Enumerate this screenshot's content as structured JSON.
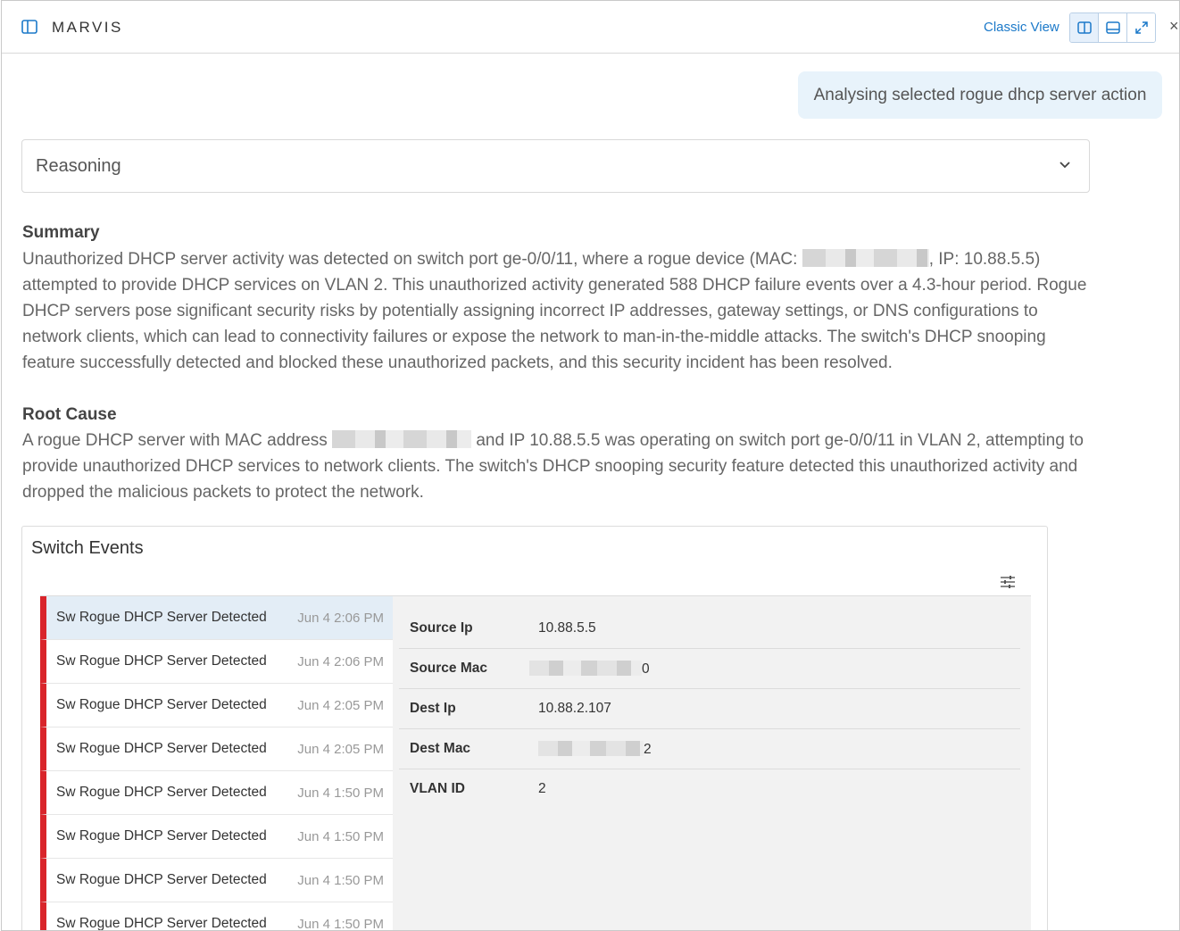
{
  "header": {
    "brand": "MARVIS",
    "classic_view": "Classic View",
    "buttons": [
      "split-view-icon",
      "bottom-panel-icon",
      "expand-icon"
    ],
    "close": "×"
  },
  "chat": {
    "user_message": "Analysing selected rogue dhcp server action"
  },
  "reasoning": {
    "label": "Reasoning"
  },
  "summary": {
    "title": "Summary",
    "text_before_mac": "Unauthorized DHCP server activity was detected on switch port ge-0/0/11, where a rogue device (MAC: ",
    "text_after_mac": ", IP: 10.88.5.5) attempted to provide DHCP services on VLAN 2. This unauthorized activity generated 588 DHCP failure events over a 4.3-hour period. Rogue DHCP servers pose significant security risks by potentially assigning incorrect IP addresses, gateway settings, or DNS configurations to network clients, which can lead to connectivity failures or expose the network to man-in-the-middle attacks. The switch's DHCP snooping feature successfully detected and blocked these unauthorized packets, and this security incident has been resolved."
  },
  "root_cause": {
    "title": "Root Cause",
    "text_before_mac": "A rogue DHCP server with MAC address ",
    "text_after_mac": " and IP 10.88.5.5 was operating on switch port ge-0/0/11 in VLAN 2, attempting to provide unauthorized DHCP services to network clients. The switch's DHCP snooping security feature detected this unauthorized activity and dropped the malicious packets to protect the network."
  },
  "switch_events": {
    "title": "Switch Events",
    "events": [
      {
        "name": "Sw Rogue DHCP Server Detected",
        "time": "Jun 4 2:06 PM"
      },
      {
        "name": "Sw Rogue DHCP Server Detected",
        "time": "Jun 4 2:06 PM"
      },
      {
        "name": "Sw Rogue DHCP Server Detected",
        "time": "Jun 4 2:05 PM"
      },
      {
        "name": "Sw Rogue DHCP Server Detected",
        "time": "Jun 4 2:05 PM"
      },
      {
        "name": "Sw Rogue DHCP Server Detected",
        "time": "Jun 4 1:50 PM"
      },
      {
        "name": "Sw Rogue DHCP Server Detected",
        "time": "Jun 4 1:50 PM"
      },
      {
        "name": "Sw Rogue DHCP Server Detected",
        "time": "Jun 4 1:50 PM"
      },
      {
        "name": "Sw Rogue DHCP Server Detected",
        "time": "Jun 4 1:50 PM"
      }
    ],
    "details": [
      {
        "key": "Source Ip",
        "value": "10.88.5.5"
      },
      {
        "key": "Source Mac",
        "value": "0"
      },
      {
        "key": "Dest Ip",
        "value": "10.88.2.107"
      },
      {
        "key": "Dest Mac",
        "value": "2"
      },
      {
        "key": "VLAN ID",
        "value": "2"
      }
    ]
  },
  "colors": {
    "accent": "#1b79c9",
    "event_marker": "#d9252b",
    "selected_row": "#e3edf6",
    "bubble": "#e8f3fb"
  }
}
